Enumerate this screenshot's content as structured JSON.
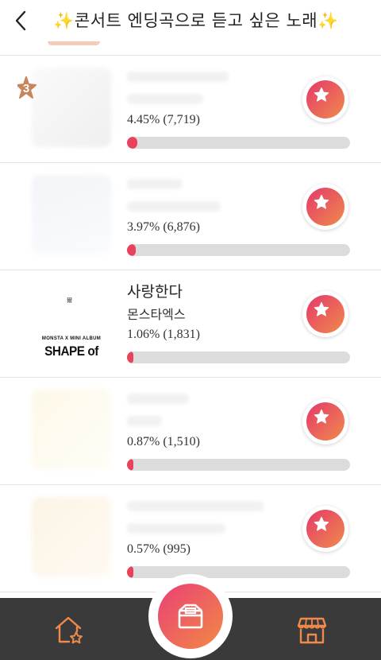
{
  "header": {
    "title": "✨콘서트 엔딩곡으로 듣고 싶은 노래✨",
    "back_icon": "chevron-left-icon"
  },
  "rows": [
    {
      "rank": "3",
      "song": "",
      "artist": "",
      "stat": "4.45% (7,719)",
      "percent": 4.45,
      "votes": 7719,
      "vote_icon": "star-icon"
    },
    {
      "song": "",
      "artist": "",
      "stat": "3.97% (6,876)",
      "percent": 3.97,
      "votes": 6876,
      "vote_icon": "star-icon"
    },
    {
      "song": "사랑한다",
      "artist": "몬스타엑스",
      "stat": "1.06% (1,831)",
      "percent": 1.06,
      "votes": 1831,
      "album": {
        "mark": "爾",
        "subtitle": "MONSTA X MINI ALBUM",
        "title": "SHAPE of LOVE"
      },
      "vote_icon": "star-icon"
    },
    {
      "song": "",
      "artist": "",
      "stat": "0.87% (1,510)",
      "percent": 0.87,
      "votes": 1510,
      "vote_icon": "star-icon"
    },
    {
      "song": "",
      "artist": "",
      "stat": "0.57% (995)",
      "percent": 0.57,
      "votes": 995,
      "vote_icon": "star-icon"
    }
  ],
  "tabbar": {
    "left_icon": "home-star-icon",
    "center_icon": "ballot-box-icon",
    "right_icon": "store-icon"
  },
  "colors": {
    "accent_start": "#e4396b",
    "accent_end": "#f08a4b",
    "bar_fill": "#e8435b",
    "bar_track": "#dcdcdc",
    "tabbar_bg": "#3a3a3a",
    "tab_icon": "#f08a4b",
    "rank_badge": "#c8845a"
  }
}
